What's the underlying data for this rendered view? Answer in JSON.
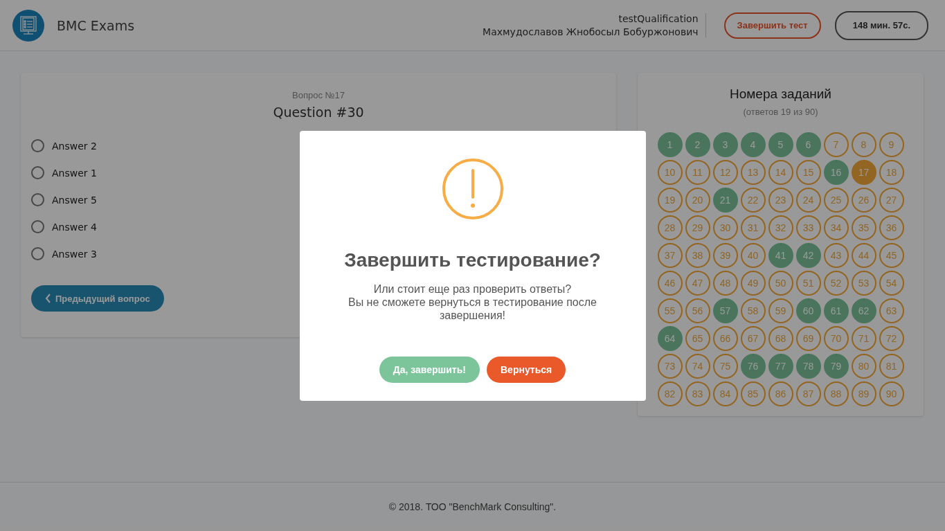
{
  "header": {
    "title": "BMC Exams",
    "test_name": "testQualification",
    "user_name": "Махмудославов Жнобосыл Бобуржонович",
    "finish_button": "Завершить тест",
    "timer": "148 мин. 57с."
  },
  "question": {
    "number": "Вопрос №17",
    "title": "Question #30",
    "answers": [
      {
        "label": "Answer 2",
        "selected": false
      },
      {
        "label": "Answer 1",
        "selected": false
      },
      {
        "label": "Answer 5",
        "selected": false
      },
      {
        "label": "Answer 4",
        "selected": false
      },
      {
        "label": "Answer 3",
        "selected": false
      }
    ],
    "prev_button": "Предыдущий вопрос"
  },
  "tasks": {
    "title": "Номера заданий",
    "subtitle": "(ответов 19 из 90)",
    "items": [
      {
        "label": "1",
        "answered": true,
        "selected": false
      },
      {
        "label": "2",
        "answered": true,
        "selected": false
      },
      {
        "label": "3",
        "answered": true,
        "selected": false
      },
      {
        "label": "4",
        "answered": true,
        "selected": false
      },
      {
        "label": "5",
        "answered": true,
        "selected": false
      },
      {
        "label": "6",
        "answered": true,
        "selected": false
      },
      {
        "label": "7",
        "answered": false,
        "selected": false
      },
      {
        "label": "8",
        "answered": false,
        "selected": false
      },
      {
        "label": "9",
        "answered": false,
        "selected": false
      },
      {
        "label": "10",
        "answered": false,
        "selected": false
      },
      {
        "label": "11",
        "answered": false,
        "selected": false
      },
      {
        "label": "12",
        "answered": false,
        "selected": false
      },
      {
        "label": "13",
        "answered": false,
        "selected": false
      },
      {
        "label": "14",
        "answered": false,
        "selected": false
      },
      {
        "label": "15",
        "answered": false,
        "selected": false
      },
      {
        "label": "16",
        "answered": true,
        "selected": false
      },
      {
        "label": "17",
        "answered": false,
        "selected": true
      },
      {
        "label": "18",
        "answered": false,
        "selected": false
      },
      {
        "label": "19",
        "answered": false,
        "selected": false
      },
      {
        "label": "20",
        "answered": false,
        "selected": false
      },
      {
        "label": "21",
        "answered": true,
        "selected": false
      },
      {
        "label": "22",
        "answered": false,
        "selected": false
      },
      {
        "label": "23",
        "answered": false,
        "selected": false
      },
      {
        "label": "24",
        "answered": false,
        "selected": false
      },
      {
        "label": "25",
        "answered": false,
        "selected": false
      },
      {
        "label": "26",
        "answered": false,
        "selected": false
      },
      {
        "label": "27",
        "answered": false,
        "selected": false
      },
      {
        "label": "28",
        "answered": false,
        "selected": false
      },
      {
        "label": "29",
        "answered": false,
        "selected": false
      },
      {
        "label": "30",
        "answered": false,
        "selected": false
      },
      {
        "label": "31",
        "answered": false,
        "selected": false
      },
      {
        "label": "32",
        "answered": false,
        "selected": false
      },
      {
        "label": "33",
        "answered": false,
        "selected": false
      },
      {
        "label": "34",
        "answered": false,
        "selected": false
      },
      {
        "label": "35",
        "answered": false,
        "selected": false
      },
      {
        "label": "36",
        "answered": false,
        "selected": false
      },
      {
        "label": "37",
        "answered": false,
        "selected": false
      },
      {
        "label": "38",
        "answered": false,
        "selected": false
      },
      {
        "label": "39",
        "answered": false,
        "selected": false
      },
      {
        "label": "40",
        "answered": false,
        "selected": false
      },
      {
        "label": "41",
        "answered": true,
        "selected": false
      },
      {
        "label": "42",
        "answered": true,
        "selected": false
      },
      {
        "label": "43",
        "answered": false,
        "selected": false
      },
      {
        "label": "44",
        "answered": false,
        "selected": false
      },
      {
        "label": "45",
        "answered": false,
        "selected": false
      },
      {
        "label": "46",
        "answered": false,
        "selected": false
      },
      {
        "label": "47",
        "answered": false,
        "selected": false
      },
      {
        "label": "48",
        "answered": false,
        "selected": false
      },
      {
        "label": "49",
        "answered": false,
        "selected": false
      },
      {
        "label": "50",
        "answered": false,
        "selected": false
      },
      {
        "label": "51",
        "answered": false,
        "selected": false
      },
      {
        "label": "52",
        "answered": false,
        "selected": false
      },
      {
        "label": "53",
        "answered": false,
        "selected": false
      },
      {
        "label": "54",
        "answered": false,
        "selected": false
      },
      {
        "label": "55",
        "answered": false,
        "selected": false
      },
      {
        "label": "56",
        "answered": false,
        "selected": false
      },
      {
        "label": "57",
        "answered": true,
        "selected": false
      },
      {
        "label": "58",
        "answered": false,
        "selected": false
      },
      {
        "label": "59",
        "answered": false,
        "selected": false
      },
      {
        "label": "60",
        "answered": true,
        "selected": false
      },
      {
        "label": "61",
        "answered": true,
        "selected": false
      },
      {
        "label": "62",
        "answered": true,
        "selected": false
      },
      {
        "label": "63",
        "answered": false,
        "selected": false
      },
      {
        "label": "64",
        "answered": true,
        "selected": false
      },
      {
        "label": "65",
        "answered": false,
        "selected": false
      },
      {
        "label": "66",
        "answered": false,
        "selected": false
      },
      {
        "label": "67",
        "answered": false,
        "selected": false
      },
      {
        "label": "68",
        "answered": false,
        "selected": false
      },
      {
        "label": "69",
        "answered": false,
        "selected": false
      },
      {
        "label": "70",
        "answered": false,
        "selected": false
      },
      {
        "label": "71",
        "answered": false,
        "selected": false
      },
      {
        "label": "72",
        "answered": false,
        "selected": false
      },
      {
        "label": "73",
        "answered": false,
        "selected": false
      },
      {
        "label": "74",
        "answered": false,
        "selected": false
      },
      {
        "label": "75",
        "answered": false,
        "selected": false
      },
      {
        "label": "76",
        "answered": true,
        "selected": false
      },
      {
        "label": "77",
        "answered": true,
        "selected": false
      },
      {
        "label": "78",
        "answered": true,
        "selected": false
      },
      {
        "label": "79",
        "answered": true,
        "selected": false
      },
      {
        "label": "80",
        "answered": false,
        "selected": false
      },
      {
        "label": "81",
        "answered": false,
        "selected": false
      },
      {
        "label": "82",
        "answered": false,
        "selected": false
      },
      {
        "label": "83",
        "answered": false,
        "selected": false
      },
      {
        "label": "84",
        "answered": false,
        "selected": false
      },
      {
        "label": "85",
        "answered": false,
        "selected": false
      },
      {
        "label": "86",
        "answered": false,
        "selected": false
      },
      {
        "label": "87",
        "answered": false,
        "selected": false
      },
      {
        "label": "88",
        "answered": false,
        "selected": false
      },
      {
        "label": "89",
        "answered": false,
        "selected": false
      },
      {
        "label": "90",
        "answered": false,
        "selected": false
      }
    ]
  },
  "footer": "© 2018. ТОО \"BenchMark Consulting\".",
  "dialog": {
    "title": "Завершить тестирование?",
    "lines": [
      "Или стоит еще раз проверить ответы?",
      "Вы не сможете вернуться в тестирование после завершения!"
    ],
    "confirm_button": "Да, завершить!",
    "cancel_button": "Вернуться"
  }
}
